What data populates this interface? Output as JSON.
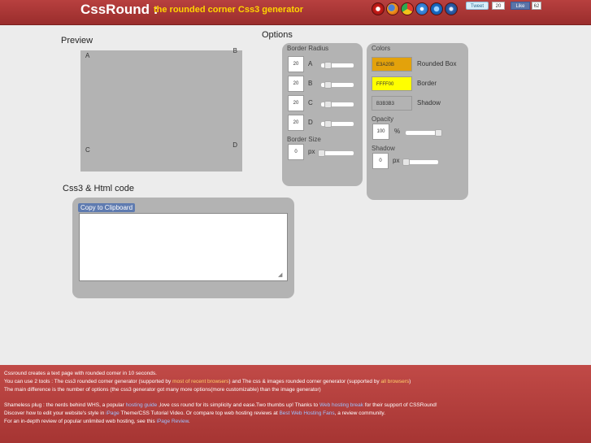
{
  "header": {
    "title": "CssRound",
    "separator": ":",
    "subtitle": "the rounded corner Css3 generator",
    "browser_icons": [
      "opera-icon",
      "firefox-icon",
      "chrome-icon",
      "safari-icon",
      "ie-icon",
      "netscape-icon"
    ],
    "tweet_label": "Tweet",
    "tweet_count": "20",
    "like_label": "Like",
    "like_count": "62"
  },
  "preview": {
    "title": "Preview",
    "box_color": "#B3B3B3",
    "corners": {
      "a": "A",
      "b": "B",
      "c": "C",
      "d": "D"
    }
  },
  "options": {
    "title": "Options",
    "border_radius": {
      "heading": "Border Radius",
      "rows": [
        {
          "label": "A",
          "value": "20"
        },
        {
          "label": "B",
          "value": "20"
        },
        {
          "label": "C",
          "value": "20"
        },
        {
          "label": "D",
          "value": "20"
        }
      ]
    },
    "border_size": {
      "heading": "Border Size",
      "value": "0",
      "unit": "px"
    },
    "colors": {
      "heading": "Colors",
      "rounded_box": {
        "value": "E3A20B",
        "label": "Rounded Box"
      },
      "border": {
        "value": "FFFF00",
        "label": "Border"
      },
      "shadow": {
        "value": "B3B3B3",
        "label": "Shadow"
      }
    },
    "opacity": {
      "heading": "Opacity",
      "value": "100",
      "unit": "%"
    },
    "shadow": {
      "heading": "Shadow",
      "value": "0",
      "unit": "px"
    }
  },
  "code": {
    "title": "Css3 & Html code",
    "copy_button": "Copy to Clipboard",
    "textarea_value": ""
  },
  "footer": {
    "line1": "Cssround creates a text page with rounded corner in 10 seconds.",
    "line2_a": "You can use 2 tools : The css3 rounded corner generator (supported by ",
    "line2_link1": "most of recent browsers",
    "line2_b": ") and The css & images rounded corner generator (supported by ",
    "line2_link2": "all browsers",
    "line2_c": ")",
    "line3": "The main difference is the number of options (the css3 generator got many more options(more customizable) than the image generator)",
    "plug_a": "Shameless plug : the nerds behind WHS, a popular ",
    "plug_link1": "hosting guide",
    "plug_b": " ,love css round for its simplicity and ease.Two thumbs up! Thanks to ",
    "plug_link2": "Web hosting break",
    "plug_c": " for their support of CSSRound!",
    "discover_a": "Discover how to edit your website's style in ",
    "discover_link1": "iPage",
    "discover_b": " Theme/CSS Tutorial Video. Or compare top web hosting reviews at ",
    "discover_link2": "Best Web Hosting Fans",
    "discover_c": ", a review community.",
    "review_a": "For an in-depth review of popular unlimited web hosting, see this ",
    "review_link": "iPage Review",
    "review_b": "."
  }
}
